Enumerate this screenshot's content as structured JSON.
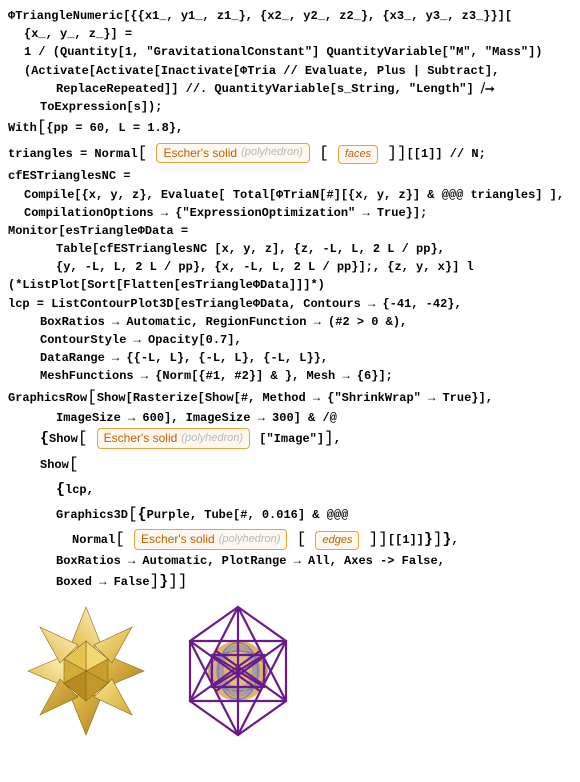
{
  "line1": "ΦTriangleNumeric[{{x1_, y1_, z1_}, {x2_, y2_, z2_}, {x3_, y3_, z3_}}][",
  "line2": "{x_, y_, z_}] =",
  "line3": "1 / (Quantity[1, \"GravitationalConstant\"] QuantityVariable[\"M\", \"Mass\"])",
  "line4": "(Activate[Activate[Inactivate[ΦTria // Evaluate, Plus | Subtract],",
  "line5": "ReplaceRepeated]] //. QuantityVariable[s_String, \"Length\"] ⧸⭢",
  "line6": "ToExpression[s]);",
  "line7a": "With",
  "line7b": "{pp = 60, L = 1.8},",
  "line8a": "triangles = Normal",
  "pill_escher_label": "Escher's solid",
  "pill_escher_sub": "(polyhedron)",
  "pill_faces": "faces",
  "line8b": "[[1]] // N;",
  "line9": "cfESTrianglesNC =",
  "line10": "Compile[{x, y, z}, Evaluate[ Total[ΦTriaN[#][{x, y, z}] & @@@ triangles] ],",
  "line11": "CompilationOptions → {\"ExpressionOptimization\" → True}];",
  "line12": "Monitor[esTriangleΦData =",
  "line13": "Table[cfESTrianglesNC [x, y, z], {z, -L, L, 2 L / pp},",
  "line14": "{y, -L, L, 2 L / pp},  {x, -L, L, 2 L / pp}];, {z, y, x}] l",
  "line15": "(*ListPlot[Sort[Flatten[esTriangleΦData]]]*)",
  "line16": "lcp = ListContourPlot3D[esTriangleΦData, Contours → {-41, -42},",
  "line17": "BoxRatios → Automatic,  RegionFunction → (#2 > 0 &),",
  "line18": "ContourStyle → Opacity[0.7],",
  "line19": "DataRange → {{-L, L}, {-L, L}, {-L, L}},",
  "line20": "MeshFunctions → {Norm[{#1, #2}] & }, Mesh → {6}];",
  "line21a": "GraphicsRow",
  "line21b": "Show[Rasterize[Show[#, Method → {\"ShrinkWrap\" → True}],",
  "line22": "ImageSize → 600], ImageSize → 300] & /@",
  "line23a": "Show",
  "line23b": "[\"Image\"]",
  "line23c": ",",
  "line24a": "Show",
  "line25a": "lcp,",
  "line26a": "Graphics3D",
  "line26b": "Purple,  Tube[#, 0.016] & @@@",
  "line27a": "Normal",
  "pill_edges": "edges",
  "line27b": "[[1]]",
  "line28": "BoxRatios → Automatic, PlotRange → All, Axes -> False,",
  "line29": "Boxed → False"
}
